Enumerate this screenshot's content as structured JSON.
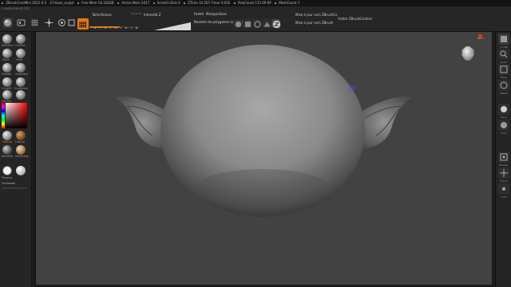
{
  "statusbar": {
    "items": [
      "ZBrushCoreMini 2021.6.5",
      "27-base_sculpt",
      "Free Mem 56.326GB",
      "Active Mem 2017",
      "Scratch Disk 0",
      "ZTime 10.265 Timer 0.002",
      "PolyCount 115.69 KP",
      "MeshCount 1"
    ]
  },
  "toolbar": {
    "tool_name": "3 A3D5 SUB 03 270",
    "brush_label": "Taille Brosse",
    "brush_sub": "Dynamic",
    "intensity_label": "Intensité Z",
    "fade_label": "Fadeit",
    "mask_label": "Masque",
    "mask_value": "Basé",
    "poly_label": "Nombre de polygones actifs: 115",
    "update_zbrushcore": "Mise à jour vers ZBrushCo",
    "update_zbrush": "Mise à jour vers ZBrush",
    "status_label": "Visiter ZBrushCentral"
  },
  "lefttray": {
    "brushes": [
      "Standard",
      "ClayBuil",
      "Move",
      "Inflat",
      "Smooth",
      "SnakeHoo",
      "ChiselFr",
      "ClayBuilde",
      "Damian",
      "ChiselS",
      "DamSta"
    ],
    "material": "MatCap",
    "material2": "FlatCap",
    "material3": "BasicMat",
    "material4": "SkinShade",
    "material5": "Polygrps",
    "occlusion_label": "Occlusion"
  },
  "righttray": {
    "items": [
      "Sculpt",
      "Zoom",
      "Move",
      "Rotate",
      "Trans",
      "Floor",
      "Perspec",
      "Frame",
      "Local"
    ]
  },
  "colors": {
    "accent": "#e07a1c",
    "canvas_bg": "#424242",
    "panel": "#262626"
  }
}
